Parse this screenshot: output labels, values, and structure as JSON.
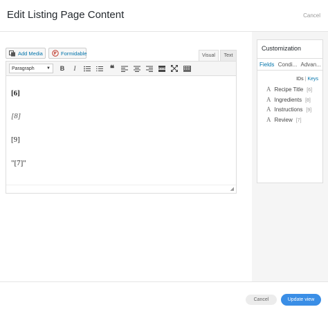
{
  "header": {
    "title": "Edit Listing Page Content",
    "cancel_label": "Cancel"
  },
  "editor": {
    "add_media_label": "Add Media",
    "formidable_label": "Formidable",
    "tabs": {
      "visual": "Visual",
      "text": "Text"
    },
    "format_select": "Paragraph",
    "content_lines": [
      "[6]",
      "[8]",
      "[9]",
      "\"[7]\""
    ]
  },
  "sidebar": {
    "title": "Customization",
    "tabs": [
      "Fields",
      "Condi...",
      "Advan..."
    ],
    "ids_label": "IDs",
    "keys_label": "Keys",
    "fields": [
      {
        "name": "Recipe Title",
        "id": "[6]"
      },
      {
        "name": "Ingredients",
        "id": "[8]"
      },
      {
        "name": "Instructions",
        "id": "[9]"
      },
      {
        "name": "Review",
        "id": "[7]"
      }
    ]
  },
  "footer": {
    "cancel_label": "Cancel",
    "update_label": "Update view"
  },
  "colors": {
    "accent": "#3a8ee6",
    "link": "#0073aa"
  }
}
